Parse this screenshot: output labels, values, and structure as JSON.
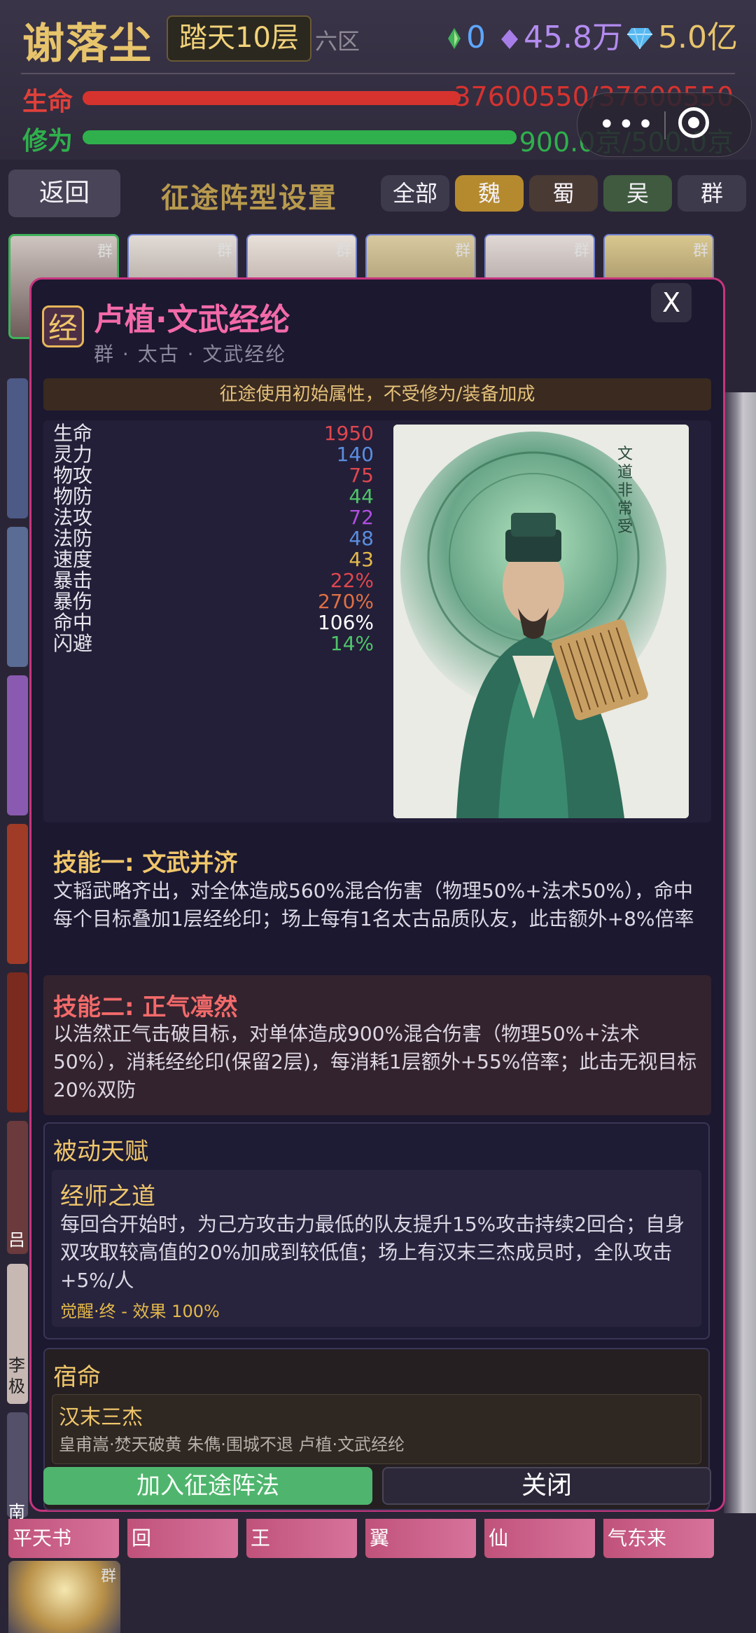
{
  "header": {
    "player_name": "谢落尘",
    "rank": "踏天10层",
    "zone": "六区",
    "currencies": [
      {
        "icon": "green-gem-icon",
        "value": "0",
        "color": "#5da7ff"
      },
      {
        "icon": "purple-diamond-icon",
        "value": "45.8万",
        "color": "#b38cf0"
      },
      {
        "icon": "blue-diamond-icon",
        "value": "5.0亿",
        "color": "#e7c46b"
      }
    ],
    "hp_label": "生命",
    "hp_value": "37600550/37600550",
    "hp_fill": 1.0,
    "cult_label": "修为",
    "cult_value": "900.0京/500.0京",
    "cult_fill": 1.0,
    "hp_color": "#d6332f",
    "cult_color": "#2fb04c"
  },
  "nav": {
    "back_label": "返回",
    "title": "征途阵型设置",
    "filters": [
      {
        "label": "全部",
        "active": false
      },
      {
        "label": "魏",
        "active": true
      },
      {
        "label": "蜀",
        "active": false
      },
      {
        "label": "吴",
        "active": false
      },
      {
        "label": "群",
        "active": false
      }
    ]
  },
  "grid": {
    "faction_tag": "群",
    "bottom_labels": [
      "平天书",
      "回",
      "王",
      "翼",
      "仙",
      "气东来"
    ],
    "side_labels": [
      "吕",
      "李极",
      "南"
    ]
  },
  "modal": {
    "close_label": "X",
    "icon_char": "经",
    "hero_name": "卢植·文武经纶",
    "hero_sub": "群 · 太古 · 文武经纶",
    "notice": "征途使用初始属性，不受修为/装备加成",
    "stats": [
      {
        "name": "生命",
        "value": "1950",
        "color": "#e0474f"
      },
      {
        "name": "灵力",
        "value": "140",
        "color": "#5a8ee0"
      },
      {
        "name": "物攻",
        "value": "75",
        "color": "#e0474f"
      },
      {
        "name": "物防",
        "value": "44",
        "color": "#4fc46a"
      },
      {
        "name": "法攻",
        "value": "72",
        "color": "#b14fe0"
      },
      {
        "name": "法防",
        "value": "48",
        "color": "#5a8ee0"
      },
      {
        "name": "速度",
        "value": "43",
        "color": "#e4b94a"
      },
      {
        "name": "暴击",
        "value": "22%",
        "color": "#e0474f"
      },
      {
        "name": "暴伤",
        "value": "270%",
        "color": "#e07044"
      },
      {
        "name": "命中",
        "value": "106%",
        "color": "#ffffff"
      },
      {
        "name": "闪避",
        "value": "14%",
        "color": "#4fc46a"
      }
    ],
    "portrait_text": "文道非常受",
    "skill1_title": "技能一: 文武并济",
    "skill1_text": "文韬武略齐出，对全体造成560%混合伤害（物理50%+法术50%），命中每个目标叠加1层经纶印；场上每有1名太古品质队友，此击额外+8%倍率",
    "skill2_title": "技能二: 正气凛然",
    "skill2_text": "以浩然正气击破目标，对单体造成900%混合伤害（物理50%+法术50%），消耗经纶印(保留2层)，每消耗1层额外+55%倍率；此击无视目标20%双防",
    "passive_header": "被动天赋",
    "passive_name": "经师之道",
    "passive_text": "每回合开始时，为己方攻击力最低的队友提升15%攻击持续2回合；自身双攻取较高值的20%加成到较低值；场上有汉末三杰成员时，全队攻击+5%/人",
    "passive_awaken": "觉醒·终 - 效果 100%",
    "fate_header": "宿命",
    "fate_name": "汉末三杰",
    "fate_members": "皇甫嵩·焚天破黄 朱儁·围城不退 卢植·文武经纶",
    "join_label": "加入征途阵法",
    "close_btn_label": "关闭"
  }
}
